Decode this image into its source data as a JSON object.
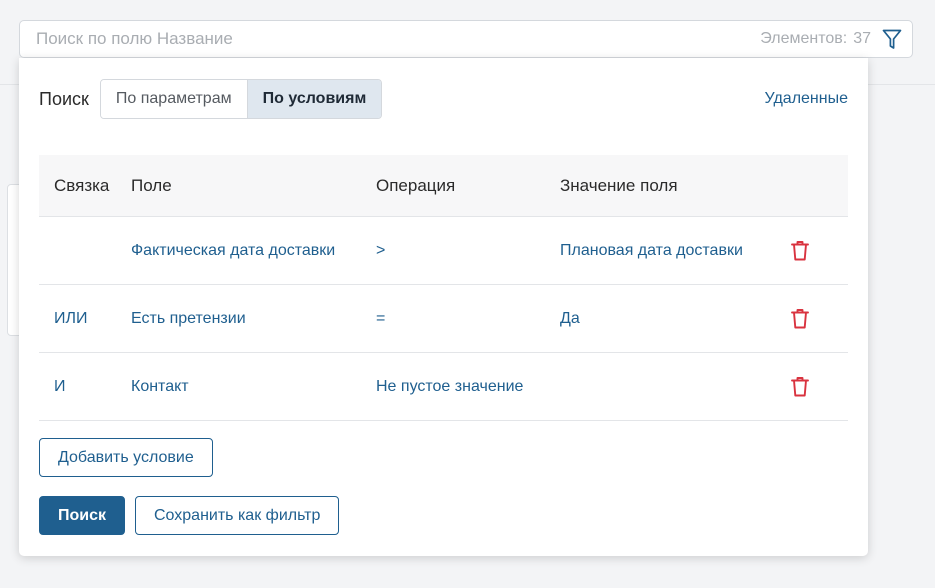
{
  "search": {
    "placeholder": "Поиск по полю Название",
    "count_label": "Элементов:",
    "count_value": "37",
    "filter_icon": "filter-funnel-icon"
  },
  "panel": {
    "title": "Поиск",
    "modes": [
      {
        "label": "По параметрам",
        "active": false
      },
      {
        "label": "По условиям",
        "active": true
      }
    ],
    "deleted_link": "Удаленные"
  },
  "table": {
    "headers": {
      "link": "Связка",
      "field": "Поле",
      "operation": "Операция",
      "value": "Значение поля"
    },
    "rows": [
      {
        "link": "",
        "field": "Фактическая дата доставки",
        "operation": ">",
        "value": "Плановая дата доставки"
      },
      {
        "link": "ИЛИ",
        "field": "Есть претензии",
        "operation": "=",
        "value": "Да"
      },
      {
        "link": "И",
        "field": "Контакт",
        "operation": "Не пустое значение",
        "value": ""
      }
    ],
    "delete_icon": "trash-icon"
  },
  "actions": {
    "add_condition": "Добавить условие",
    "search": "Поиск",
    "save_filter": "Сохранить как фильтр"
  },
  "colors": {
    "accent": "#1f5f8f",
    "delete": "#d9333f",
    "active_segment": "#dfe7ef"
  }
}
